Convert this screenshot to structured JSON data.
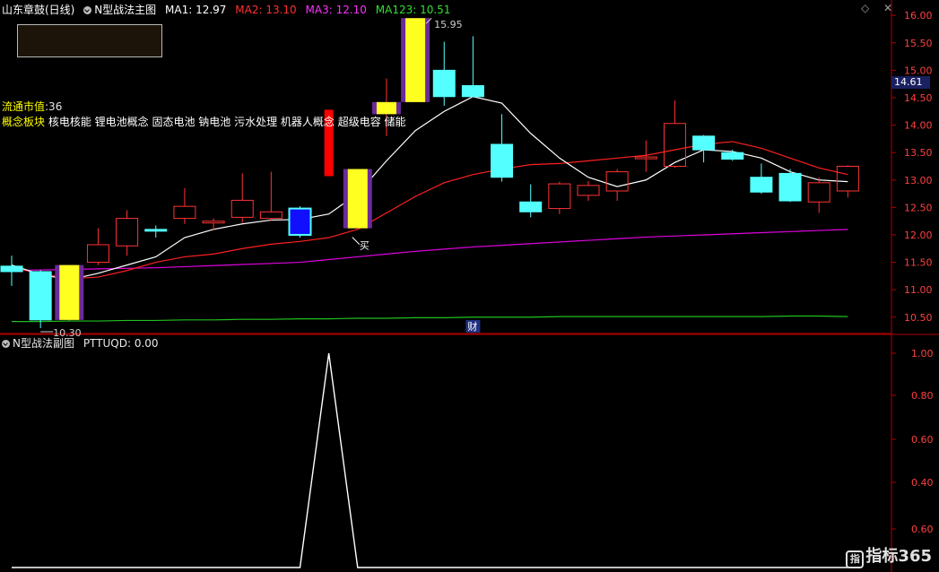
{
  "header": {
    "stock_name": "山东章鼓(日线)",
    "indicator_name": "N型战法主图",
    "ma1": "MA1: 12.97",
    "ma2": "MA2: 13.10",
    "ma3": "MA3: 12.10",
    "ma123": "MA123: 10.51"
  },
  "sub_header": {
    "indicator_name": "N型战法副图",
    "value": "PTTUQD: 0.00"
  },
  "info": {
    "float_value_label": "流通市值",
    "float_value": ":36",
    "concept_label": "概念板块",
    "concepts": "核电核能 锂电池概念 固态电池 钠电池 污水处理 机器人概念 超级电容 储能"
  },
  "current_price_tag": "14.61",
  "top_icons": "◇ ✕",
  "logo": {
    "icon": "指",
    "text": "指标365"
  },
  "colors": {
    "up": "#ff3333",
    "down": "#54ffff",
    "ma1": "#ffffff",
    "ma2": "#ff2020",
    "ma3": "#e000e0",
    "ma123": "#20c020",
    "signal": "#ffff20",
    "frame": "#b00000"
  },
  "chart_data": {
    "main": {
      "type": "candlestick",
      "ylim": [
        10.3,
        16.15
      ],
      "y_ticks": [
        "16.00",
        "15.50",
        "15.00",
        "14.50",
        "14.00",
        "13.50",
        "13.00",
        "12.50",
        "12.00",
        "11.50",
        "11.00",
        "10.50"
      ],
      "candles": [
        {
          "o": 11.43,
          "h": 11.62,
          "l": 11.07,
          "c": 11.33,
          "dir": "down"
        },
        {
          "o": 11.33,
          "h": 11.36,
          "l": 10.3,
          "c": 10.45,
          "dir": "down"
        },
        {
          "o": 10.45,
          "h": 11.45,
          "l": 10.42,
          "c": 11.45,
          "dir": "up",
          "signal": true
        },
        {
          "o": 11.5,
          "h": 12.12,
          "l": 11.45,
          "c": 11.82,
          "dir": "up"
        },
        {
          "o": 11.8,
          "h": 12.45,
          "l": 11.62,
          "c": 12.3,
          "dir": "up"
        },
        {
          "o": 12.1,
          "h": 12.17,
          "l": 11.95,
          "c": 12.07,
          "dir": "down"
        },
        {
          "o": 12.3,
          "h": 12.85,
          "l": 12.2,
          "c": 12.52,
          "dir": "up"
        },
        {
          "o": 12.25,
          "h": 12.3,
          "l": 12.08,
          "c": 12.22,
          "dir": "up"
        },
        {
          "o": 12.32,
          "h": 13.12,
          "l": 12.22,
          "c": 12.63,
          "dir": "up"
        },
        {
          "o": 12.3,
          "h": 13.15,
          "l": 12.25,
          "c": 12.42,
          "dir": "up"
        },
        {
          "o": 12.48,
          "h": 12.52,
          "l": 11.95,
          "c": 12.0,
          "dir": "blue"
        },
        {
          "o": 13.07,
          "h": 14.28,
          "l": 13.07,
          "c": 14.28,
          "dir": "redsolid"
        },
        {
          "o": 12.12,
          "h": 13.2,
          "l": 12.12,
          "c": 13.2,
          "dir": "up",
          "signal": true
        },
        {
          "o": 14.42,
          "h": 14.85,
          "l": 13.8,
          "c": 14.2,
          "dir": "up",
          "signal": true
        },
        {
          "o": 14.42,
          "h": 15.95,
          "l": 14.42,
          "c": 15.95,
          "dir": "up",
          "signal": true
        },
        {
          "o": 15.0,
          "h": 15.52,
          "l": 14.35,
          "c": 14.52,
          "dir": "down"
        },
        {
          "o": 14.72,
          "h": 15.62,
          "l": 14.52,
          "c": 14.52,
          "dir": "down"
        },
        {
          "o": 13.65,
          "h": 14.2,
          "l": 12.97,
          "c": 13.05,
          "dir": "down"
        },
        {
          "o": 12.6,
          "h": 12.92,
          "l": 12.32,
          "c": 12.42,
          "dir": "down"
        },
        {
          "o": 12.48,
          "h": 12.97,
          "l": 12.38,
          "c": 12.93,
          "dir": "up"
        },
        {
          "o": 12.72,
          "h": 12.98,
          "l": 12.62,
          "c": 12.9,
          "dir": "up"
        },
        {
          "o": 12.8,
          "h": 13.2,
          "l": 12.62,
          "c": 13.15,
          "dir": "up"
        },
        {
          "o": 13.4,
          "h": 13.72,
          "l": 13.15,
          "c": 13.42,
          "dir": "up"
        },
        {
          "o": 13.25,
          "h": 14.45,
          "l": 13.22,
          "c": 14.03,
          "dir": "up"
        },
        {
          "o": 13.8,
          "h": 13.82,
          "l": 13.32,
          "c": 13.55,
          "dir": "down"
        },
        {
          "o": 13.5,
          "h": 13.55,
          "l": 13.35,
          "c": 13.38,
          "dir": "down"
        },
        {
          "o": 13.05,
          "h": 13.3,
          "l": 12.75,
          "c": 12.78,
          "dir": "down"
        },
        {
          "o": 13.12,
          "h": 13.2,
          "l": 12.6,
          "c": 12.62,
          "dir": "down"
        },
        {
          "o": 12.6,
          "h": 13.05,
          "l": 12.4,
          "c": 12.95,
          "dir": "up"
        },
        {
          "o": 12.8,
          "h": 13.27,
          "l": 12.68,
          "c": 13.25,
          "dir": "up"
        }
      ],
      "ma1": [
        11.45,
        11.28,
        11.18,
        11.3,
        11.45,
        11.6,
        11.95,
        12.1,
        12.2,
        12.27,
        12.28,
        12.38,
        12.75,
        13.35,
        13.9,
        14.25,
        14.52,
        14.4,
        13.85,
        13.4,
        13.05,
        12.88,
        13.0,
        13.32,
        13.55,
        13.52,
        13.4,
        13.15,
        13.0,
        12.97
      ],
      "ma2": [
        11.4,
        11.3,
        11.2,
        11.23,
        11.35,
        11.5,
        11.6,
        11.65,
        11.75,
        11.83,
        11.88,
        11.95,
        12.1,
        12.4,
        12.7,
        12.95,
        13.1,
        13.2,
        13.28,
        13.3,
        13.35,
        13.4,
        13.45,
        13.55,
        13.65,
        13.7,
        13.58,
        13.4,
        13.22,
        13.1
      ],
      "ma3": [
        11.35,
        11.36,
        11.37,
        11.38,
        11.39,
        11.4,
        11.42,
        11.44,
        11.46,
        11.48,
        11.5,
        11.55,
        11.6,
        11.65,
        11.7,
        11.74,
        11.78,
        11.81,
        11.84,
        11.87,
        11.9,
        11.93,
        11.96,
        11.98,
        12.0,
        12.02,
        12.04,
        12.06,
        12.08,
        12.1
      ],
      "ma123": [
        10.42,
        10.42,
        10.43,
        10.43,
        10.44,
        10.44,
        10.45,
        10.45,
        10.46,
        10.46,
        10.47,
        10.47,
        10.48,
        10.48,
        10.49,
        10.49,
        10.5,
        10.5,
        10.5,
        10.51,
        10.51,
        10.51,
        10.51,
        10.51,
        10.51,
        10.51,
        10.51,
        10.52,
        10.52,
        10.51
      ],
      "annotations": [
        {
          "text": "15.95",
          "index": 14,
          "price": 15.95
        },
        {
          "text": "10.30",
          "index": 1,
          "price": 10.3
        },
        {
          "text": "买",
          "index": 12,
          "price": 12.12
        },
        {
          "text": "财",
          "index": 16,
          "price": 10.3
        }
      ]
    },
    "sub": {
      "type": "line",
      "ylim": [
        0.0,
        1.0
      ],
      "y_ticks": [
        "1.00",
        "0.80",
        "0.60",
        "0.40",
        "0.60"
      ],
      "values": [
        0,
        0,
        0,
        0,
        0,
        0,
        0,
        0,
        0,
        0,
        0,
        1,
        0,
        0,
        0,
        0,
        0,
        0,
        0,
        0,
        0,
        0,
        0,
        0,
        0,
        0,
        0,
        0,
        0,
        0
      ]
    }
  }
}
